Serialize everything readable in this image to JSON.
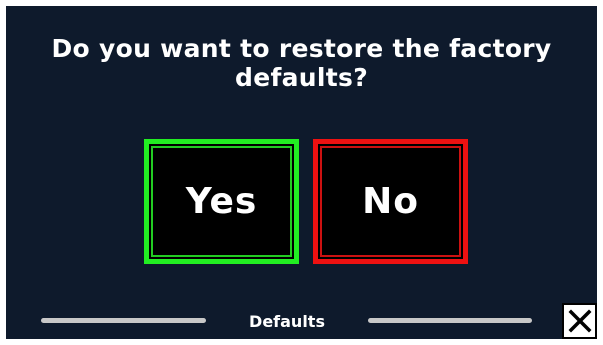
{
  "dialog": {
    "question_line1": "Do you want to restore the factory",
    "question_line2": "defaults?",
    "yes_label": "Yes",
    "no_label": "No"
  },
  "footer": {
    "title": "Defaults",
    "close_icon": "close-icon"
  },
  "colors": {
    "background": "#0e1a2c",
    "yes_border": "#22ee22",
    "no_border": "#ee1111",
    "button_fill": "#000000",
    "text": "#ffffff"
  }
}
